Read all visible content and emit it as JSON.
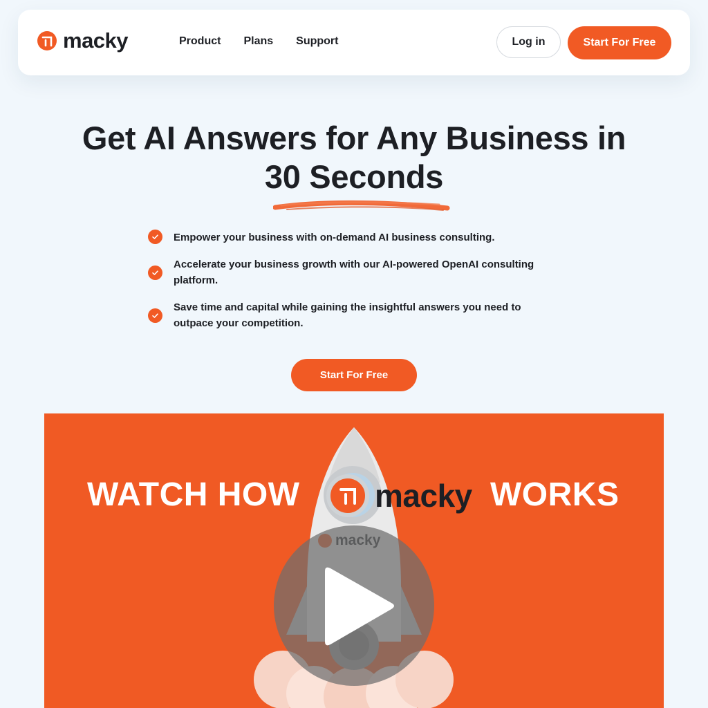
{
  "brand": {
    "name": "macky",
    "accent": "#f15a24"
  },
  "nav": {
    "links": [
      "Product",
      "Plans",
      "Support"
    ],
    "login_label": "Log in",
    "start_label": "Start For Free"
  },
  "hero": {
    "title_line1": "Get AI Answers for Any Business in",
    "title_line2": "30 Seconds",
    "bullets": [
      "Empower your business with on-demand AI business consulting.",
      "Accelerate your business growth with our AI-powered OpenAI consulting platform.",
      "Save time and capital while gaining the insightful answers you need to outpace your competition."
    ],
    "cta_label": "Start For Free"
  },
  "video": {
    "title_left": "WATCH HOW",
    "logo_text": "macky",
    "title_right": "WORKS",
    "rocket_label": "macky",
    "play_icon": "play-icon"
  }
}
